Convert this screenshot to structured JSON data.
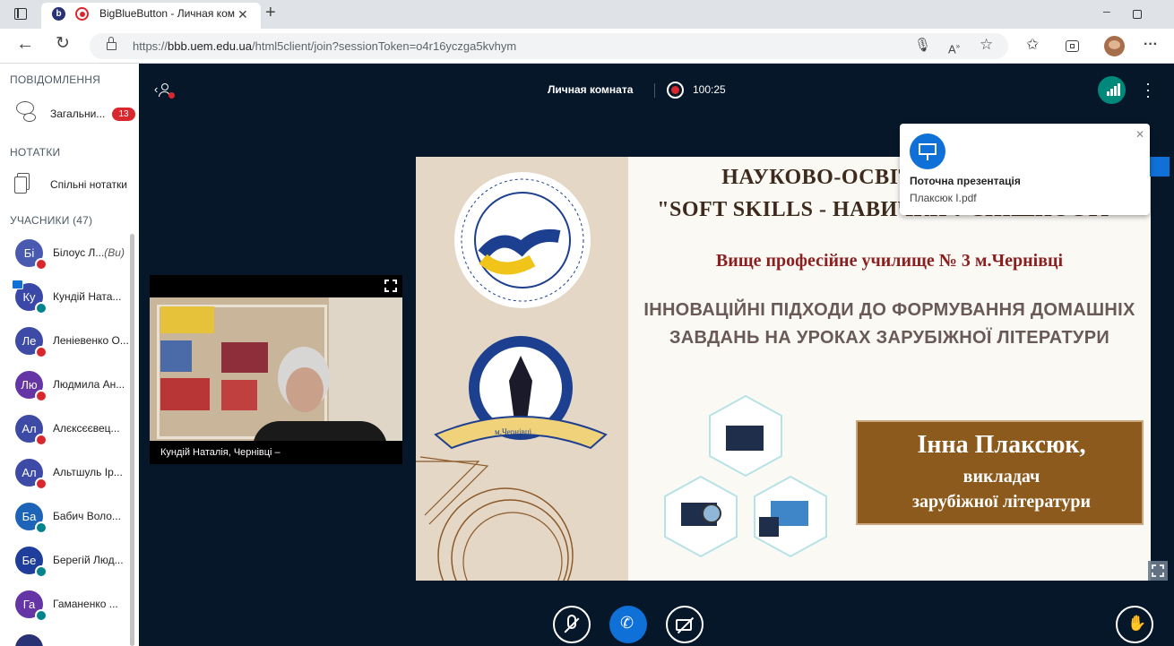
{
  "browser": {
    "tab_title": "BigBlueButton - Личная ком",
    "url_prefix": "https://",
    "url_host": "bbb.uem.edu.ua",
    "url_path": "/html5client/join?sessionToken=o4r16yczga5kvhym"
  },
  "sidebar": {
    "messages_header": "ПОВІДОМЛЕННЯ",
    "public_chat_label": "Загальни...",
    "public_chat_count": "13",
    "notes_header": "НОТАТКИ",
    "shared_notes_label": "Спільні нотатки",
    "users_header": "УЧАСНИКИ (47)",
    "users": [
      {
        "initials": "Бі",
        "name": "Білоус Л...",
        "suffix": "(Ви)",
        "color": "#4a5ab0",
        "status": "muted"
      },
      {
        "initials": "Ку",
        "name": "Кундій Ната...",
        "suffix": "",
        "color": "#3a49a8",
        "status": "listen",
        "presenter": true
      },
      {
        "initials": "Ле",
        "name": "Леніевенко О...",
        "suffix": "",
        "color": "#3d4ba6",
        "status": "muted"
      },
      {
        "initials": "Лю",
        "name": "Людмила Ан...",
        "suffix": "",
        "color": "#6535a5",
        "status": "muted"
      },
      {
        "initials": "Ал",
        "name": "Алєксєєвец...",
        "suffix": "",
        "color": "#3d4ba6",
        "status": "muted"
      },
      {
        "initials": "Ал",
        "name": "Альтшуль Ір...",
        "suffix": "",
        "color": "#3d4ba6",
        "status": "muted"
      },
      {
        "initials": "Ба",
        "name": "Бабич Воло...",
        "suffix": "",
        "color": "#1d63b8",
        "status": "listen"
      },
      {
        "initials": "Бе",
        "name": "Берегій Люд...",
        "suffix": "",
        "color": "#1f3e9c",
        "status": "listen"
      },
      {
        "initials": "Га",
        "name": "Гаманенко ...",
        "suffix": "",
        "color": "#6535a5",
        "status": "listen"
      }
    ]
  },
  "main": {
    "room_name": "Личная комната",
    "recording_time": "100:25",
    "webcam_name": "Кундій Наталія, Чернівці –"
  },
  "slide": {
    "title_line1": "НАУКОВО-ОСВІТНІЙ АЛЬЯНС",
    "title_line2": "\"SOFT SKILLS - НАВИЧКИ УСПІШНОСТІ\"",
    "school": "Вище професійне училище № 3 м.Чернівці",
    "topic_line1": "ІННОВАЦІЙНІ ПІДХОДИ ДО ФОРМУВАННЯ ДОМАШНІХ",
    "topic_line2": "ЗАВДАНЬ НА УРОКАХ ЗАРУБІЖНОЇ ЛІТЕРАТУРИ",
    "author_name": "Інна Плаксюк,",
    "author_role1": "викладач",
    "author_role2": "зарубіжної літератури",
    "logo2_text": "м.Чернівці"
  },
  "toast": {
    "title": "Поточна презентація",
    "filename": "Плаксюк І.pdf"
  },
  "colors": {
    "app_bg": "#06172a",
    "accent": "#0f70d7",
    "muted": "#d9272e",
    "listen": "#00838f",
    "connection": "#00897b"
  }
}
